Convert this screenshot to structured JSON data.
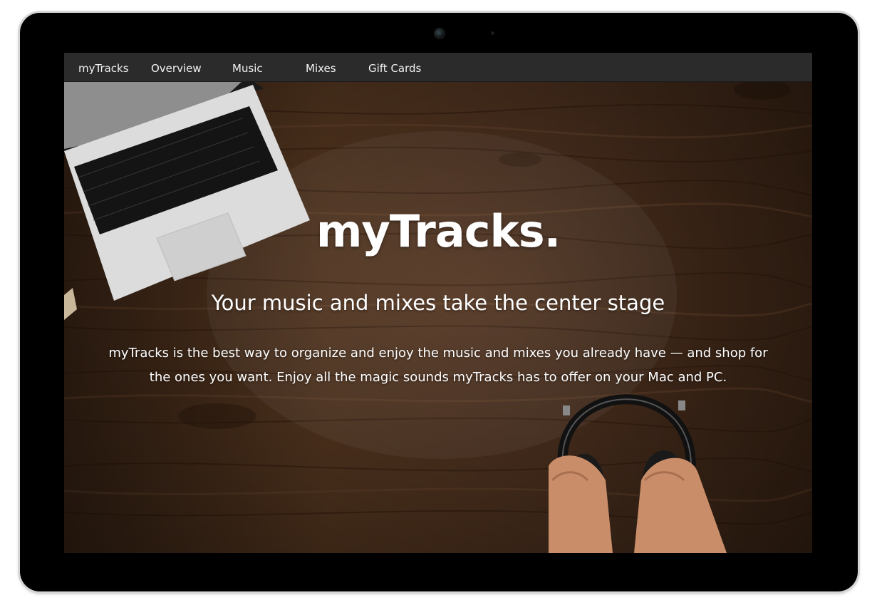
{
  "nav": {
    "brand": "myTracks",
    "items": [
      "Overview",
      "Music",
      "Mixes",
      "Gift Cards"
    ]
  },
  "hero": {
    "title": "myTracks.",
    "subtitle": "Your music and mixes take the center stage",
    "body": "myTracks is the best way to organize and enjoy the music and mixes you already have — and shop for the ones you want. Enjoy all the magic sounds myTracks has to offer on your Mac and PC."
  },
  "colors": {
    "navbar": "#2b2b2b",
    "wood": "#4a2f1b",
    "bezel": "#000000"
  }
}
